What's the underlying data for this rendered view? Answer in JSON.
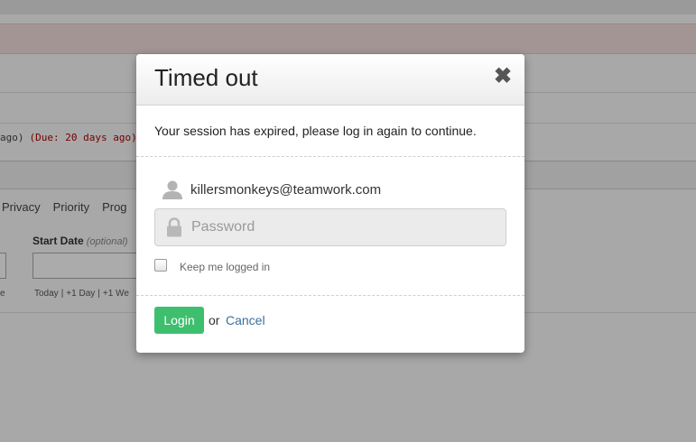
{
  "background": {
    "task_suffix": "ago)",
    "task_due": "(Due: 20 days ago)",
    "tabs": [
      "Privacy",
      "Priority",
      "Prog"
    ],
    "start_date_label": "Start Date",
    "start_date_optional": "(optional)",
    "quick_dates": [
      "Today",
      "|",
      "+1 Day",
      "|",
      "+1 We"
    ],
    "edge_text": "e"
  },
  "modal": {
    "title": "Timed out",
    "close_glyph": "✖",
    "message": "Your session has expired, please log in again to continue.",
    "user_email": "killersmonkeys@teamwork.com",
    "password_placeholder": "Password",
    "password_value": "",
    "keep_logged_in_label": "Keep me logged in",
    "keep_logged_in_checked": false,
    "login_label": "Login",
    "or_text": "or",
    "cancel_label": "Cancel"
  },
  "colors": {
    "login_button": "#3dbf6e",
    "cancel_link": "#3a6f9c",
    "due_text": "#b00000"
  },
  "icons": {
    "user": "user-icon",
    "lock": "lock-icon",
    "close": "close-icon"
  }
}
